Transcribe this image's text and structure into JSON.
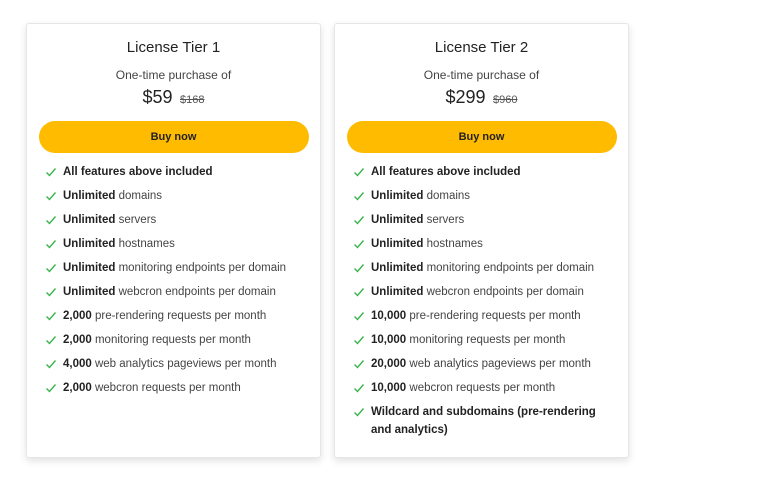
{
  "colors": {
    "accent": "#ffbb00",
    "check": "#3bb54a"
  },
  "tiers": [
    {
      "title": "License Tier 1",
      "subtitle": "One-time purchase of",
      "price": "$59",
      "old_price": "$168",
      "button": "Buy now",
      "features": [
        {
          "bold": "All features above included",
          "rest": ""
        },
        {
          "bold": "Unlimited",
          "rest": " domains"
        },
        {
          "bold": "Unlimited",
          "rest": " servers"
        },
        {
          "bold": "Unlimited",
          "rest": " hostnames"
        },
        {
          "bold": "Unlimited",
          "rest": " monitoring endpoints per domain"
        },
        {
          "bold": "Unlimited",
          "rest": " webcron endpoints per domain"
        },
        {
          "bold": "2,000",
          "rest": " pre-rendering requests per month"
        },
        {
          "bold": "2,000",
          "rest": " monitoring requests per month"
        },
        {
          "bold": "4,000",
          "rest": " web analytics pageviews per month"
        },
        {
          "bold": "2,000",
          "rest": " webcron requests per month"
        }
      ]
    },
    {
      "title": "License Tier 2",
      "subtitle": "One-time purchase of",
      "price": "$299",
      "old_price": "$960",
      "button": "Buy now",
      "features": [
        {
          "bold": "All features above included",
          "rest": ""
        },
        {
          "bold": "Unlimited",
          "rest": " domains"
        },
        {
          "bold": "Unlimited",
          "rest": " servers"
        },
        {
          "bold": "Unlimited",
          "rest": " hostnames"
        },
        {
          "bold": "Unlimited",
          "rest": " monitoring endpoints per domain"
        },
        {
          "bold": "Unlimited",
          "rest": " webcron endpoints per domain"
        },
        {
          "bold": "10,000",
          "rest": " pre-rendering requests per month"
        },
        {
          "bold": "10,000",
          "rest": " monitoring requests per month"
        },
        {
          "bold": "20,000",
          "rest": " web analytics pageviews per month"
        },
        {
          "bold": "10,000",
          "rest": " webcron requests per month"
        },
        {
          "bold": "Wildcard and subdomains (pre-rendering and analytics)",
          "rest": ""
        }
      ]
    }
  ]
}
